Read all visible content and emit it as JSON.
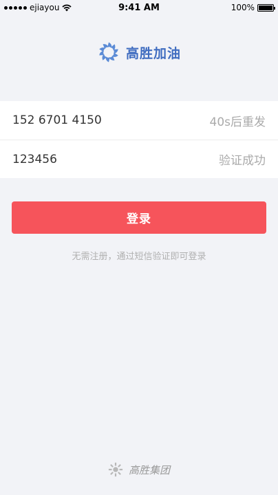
{
  "status_bar": {
    "carrier": "ejiayou",
    "time": "9:41 AM",
    "battery": "100%",
    "battery_level": 1.0
  },
  "header": {
    "brand_name": "高胜加油",
    "brand_color": "#3f6cc0"
  },
  "login_form": {
    "phone_value": "152 6701 4150",
    "resend_countdown": "40s后重发",
    "code_value": "123456",
    "verify_status": "验证成功"
  },
  "login_button": {
    "label": "登录",
    "color": "#f6545b"
  },
  "note": "无需注册，通过短信验证即可登录",
  "footer": {
    "company_name": "高胜集团"
  }
}
